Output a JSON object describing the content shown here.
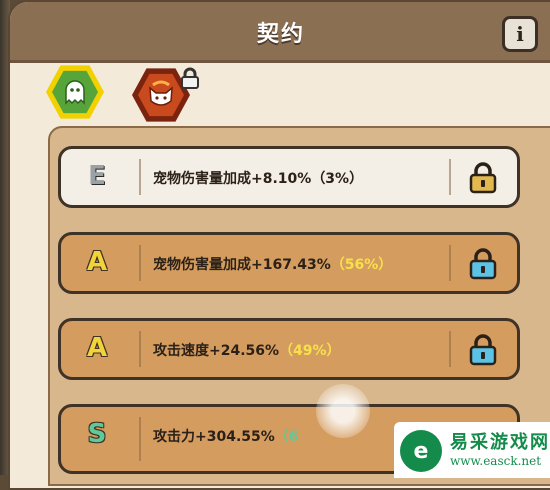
{
  "header": {
    "title": "契约",
    "info_label": "i"
  },
  "pets": [
    {
      "name": "ghost-pet",
      "locked": false
    },
    {
      "name": "fox-pet",
      "locked": true
    }
  ],
  "contract_rows": [
    {
      "grade": "E",
      "stat": "宠物伤害量加成+8.10%",
      "percent": "（3%）",
      "style": "light",
      "grade_color": "#9aa2a6"
    },
    {
      "grade": "A",
      "stat": "宠物伤害量加成+167.43%",
      "percent": "（56%）",
      "style": "orange",
      "grade_color": "#f2d43a"
    },
    {
      "grade": "A",
      "stat": "攻击速度+24.56%",
      "percent": "（49%）",
      "style": "orange",
      "grade_color": "#f2d43a"
    },
    {
      "grade": "S",
      "stat": "攻击力+304.55%",
      "percent": "（6",
      "style": "orange",
      "grade_color": "#5fc99a"
    }
  ],
  "watermark": {
    "cn": "易采游戏网",
    "url": "www.easck.net",
    "logo": "e"
  }
}
